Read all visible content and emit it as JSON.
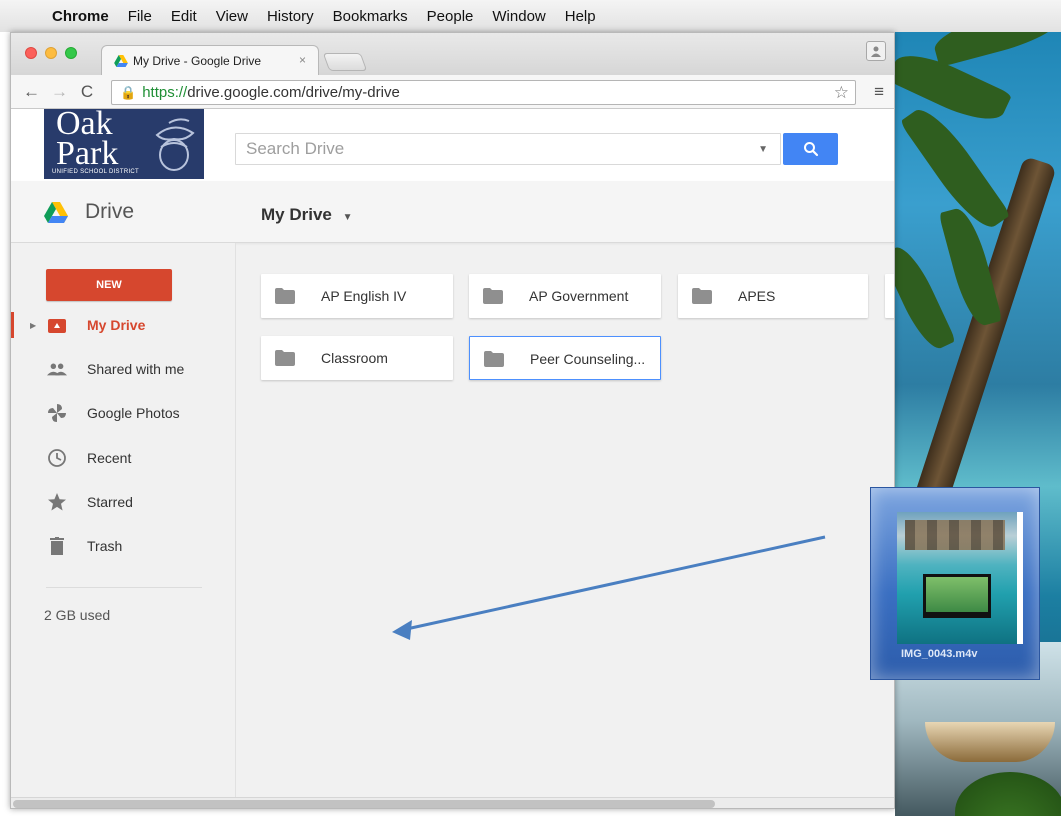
{
  "menubar": {
    "items": [
      "Chrome",
      "File",
      "Edit",
      "View",
      "History",
      "Bookmarks",
      "People",
      "Window",
      "Help"
    ]
  },
  "browser": {
    "tab_title": "My Drive - Google Drive",
    "url_scheme": "https://",
    "url_rest": "drive.google.com/drive/my-drive"
  },
  "logo": {
    "line1": "Oak",
    "line2": "Park",
    "line3": "UNIFIED SCHOOL DISTRICT"
  },
  "search": {
    "placeholder": "Search Drive"
  },
  "drive": {
    "brand": "Drive",
    "breadcrumb": "My Drive"
  },
  "sidebar": {
    "new_label": "NEW",
    "items": [
      {
        "label": "My Drive",
        "icon": "my-drive-icon",
        "active": true
      },
      {
        "label": "Shared with me",
        "icon": "people-icon"
      },
      {
        "label": "Google Photos",
        "icon": "pinwheel-icon"
      },
      {
        "label": "Recent",
        "icon": "clock-icon"
      },
      {
        "label": "Starred",
        "icon": "star-icon"
      },
      {
        "label": "Trash",
        "icon": "trash-icon"
      }
    ],
    "storage": "2 GB used"
  },
  "folders": [
    {
      "name": "AP English IV"
    },
    {
      "name": "AP Government"
    },
    {
      "name": "APES"
    },
    {
      "name": "Classroom"
    },
    {
      "name": "Peer Counseling...",
      "selected": true
    }
  ],
  "drag": {
    "file_name": "IMG_0043.m4v"
  },
  "colors": {
    "accent_red": "#d6472e",
    "search_blue": "#4285f4",
    "drag_arrow": "#4a7fc1"
  }
}
